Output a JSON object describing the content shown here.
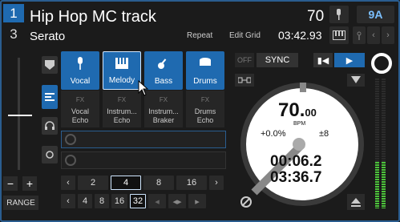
{
  "header": {
    "deck_active": "1",
    "deck_inactive": "3",
    "title": "Hip Hop MC track",
    "artist": "Serato",
    "bpm": "70",
    "key": "9A",
    "repeat": "Repeat",
    "edit_grid": "Edit Grid",
    "time": "03:42.93"
  },
  "stems": [
    {
      "label": "Vocal",
      "icon": "microphone-icon"
    },
    {
      "label": "Melody",
      "icon": "piano-icon"
    },
    {
      "label": "Bass",
      "icon": "guitar-icon"
    },
    {
      "label": "Drums",
      "icon": "drum-icon"
    }
  ],
  "fx": [
    {
      "tag": "FX",
      "name1": "Vocal",
      "name2": "Echo"
    },
    {
      "tag": "FX",
      "name1": "Instrum...",
      "name2": "Echo"
    },
    {
      "tag": "FX",
      "name1": "Instrum...",
      "name2": "Braker"
    },
    {
      "tag": "FX",
      "name1": "Drums",
      "name2": "Echo"
    }
  ],
  "loops_row1": [
    "2",
    "4",
    "8",
    "16"
  ],
  "loops_row2": [
    "4",
    "8",
    "16",
    "32"
  ],
  "controls": {
    "off": "OFF",
    "sync": "SYNC",
    "range": "RANGE"
  },
  "platter": {
    "bpm_int": "70.",
    "bpm_dec": "00",
    "bpm_unit": "BPM",
    "pitch": "+0.0%",
    "range": "±8",
    "elapsed": "00:06.2",
    "remaining": "03:36.7"
  },
  "colors": {
    "accent": "#1f6ab0",
    "key": "#7cc0ff",
    "meter": "#4cc23a"
  }
}
